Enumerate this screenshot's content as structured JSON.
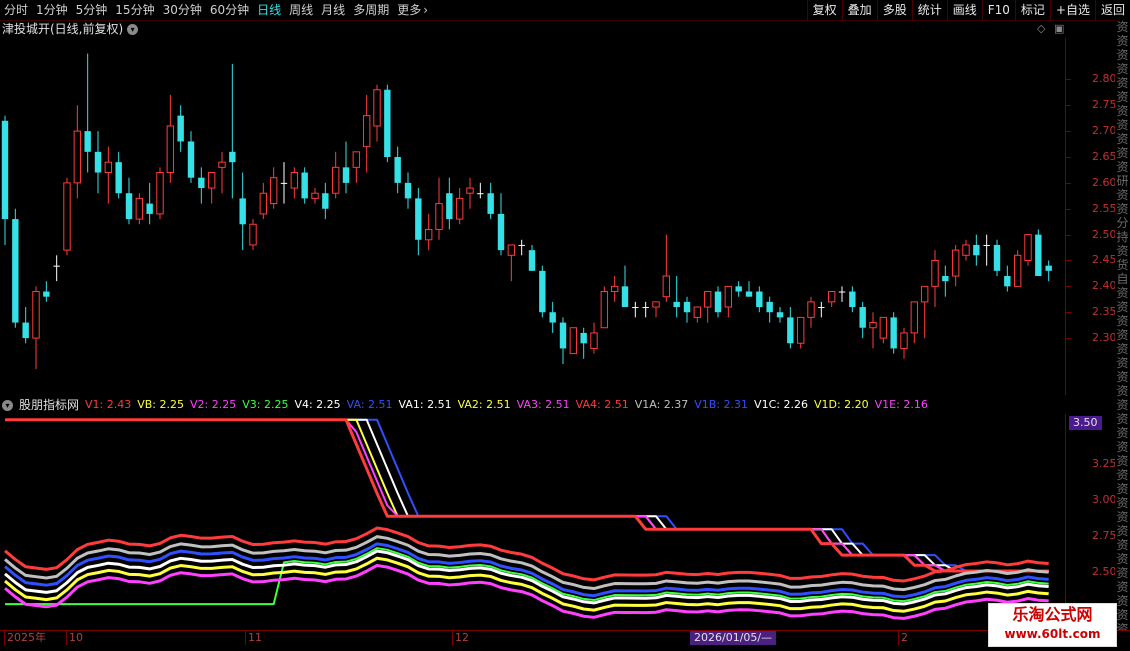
{
  "toolbar": {
    "periods": [
      "分时",
      "1分钟",
      "5分钟",
      "15分钟",
      "30分钟",
      "60分钟",
      "日线",
      "周线",
      "月线",
      "多周期",
      "更多"
    ],
    "active_period": "日线",
    "more_arrow": "›",
    "right_buttons": [
      "复权",
      "叠加",
      "多股",
      "统计",
      "画线",
      "F10",
      "标记",
      "+自选",
      "返回"
    ]
  },
  "main": {
    "title": "津投城开(日线,前复权)",
    "icon_names": [
      "chevron-down-icon",
      "diamond-icon",
      "window-icon"
    ],
    "up_color": "#ff3b3b",
    "down_color": "#35e0e6",
    "flat_color": "#ffffff",
    "y_range": [
      2.19,
      2.88
    ],
    "y_ticks": [
      "2.80",
      "2.75",
      "2.70",
      "2.65",
      "2.60",
      "2.55",
      "2.50",
      "2.45",
      "2.40",
      "2.35",
      "2.30"
    ],
    "candles": [
      [
        2.72,
        2.73,
        2.48,
        2.53
      ],
      [
        2.53,
        2.55,
        2.32,
        2.33
      ],
      [
        2.33,
        2.36,
        2.29,
        2.3
      ],
      [
        2.3,
        2.4,
        2.24,
        2.39
      ],
      [
        2.39,
        2.41,
        2.37,
        2.38
      ],
      [
        2.44,
        2.46,
        2.41,
        2.44
      ],
      [
        2.47,
        2.61,
        2.46,
        2.6
      ],
      [
        2.6,
        2.75,
        2.57,
        2.7
      ],
      [
        2.7,
        2.85,
        2.62,
        2.66
      ],
      [
        2.66,
        2.7,
        2.58,
        2.62
      ],
      [
        2.62,
        2.67,
        2.56,
        2.64
      ],
      [
        2.64,
        2.66,
        2.57,
        2.58
      ],
      [
        2.58,
        2.61,
        2.52,
        2.53
      ],
      [
        2.53,
        2.58,
        2.52,
        2.57
      ],
      [
        2.56,
        2.6,
        2.52,
        2.54
      ],
      [
        2.54,
        2.63,
        2.53,
        2.62
      ],
      [
        2.62,
        2.77,
        2.6,
        2.71
      ],
      [
        2.73,
        2.75,
        2.66,
        2.68
      ],
      [
        2.68,
        2.7,
        2.6,
        2.61
      ],
      [
        2.61,
        2.63,
        2.56,
        2.59
      ],
      [
        2.59,
        2.62,
        2.56,
        2.62
      ],
      [
        2.63,
        2.66,
        2.58,
        2.64
      ],
      [
        2.66,
        2.83,
        2.57,
        2.64
      ],
      [
        2.57,
        2.62,
        2.47,
        2.52
      ],
      [
        2.48,
        2.53,
        2.47,
        2.52
      ],
      [
        2.54,
        2.6,
        2.53,
        2.58
      ],
      [
        2.56,
        2.63,
        2.55,
        2.61
      ],
      [
        2.6,
        2.64,
        2.56,
        2.6
      ],
      [
        2.59,
        2.63,
        2.57,
        2.62
      ],
      [
        2.62,
        2.63,
        2.56,
        2.57
      ],
      [
        2.57,
        2.59,
        2.56,
        2.58
      ],
      [
        2.58,
        2.6,
        2.53,
        2.55
      ],
      [
        2.58,
        2.66,
        2.57,
        2.63
      ],
      [
        2.63,
        2.68,
        2.58,
        2.6
      ],
      [
        2.63,
        2.66,
        2.6,
        2.66
      ],
      [
        2.67,
        2.77,
        2.62,
        2.73
      ],
      [
        2.71,
        2.79,
        2.68,
        2.78
      ],
      [
        2.78,
        2.79,
        2.64,
        2.65
      ],
      [
        2.65,
        2.67,
        2.58,
        2.6
      ],
      [
        2.6,
        2.62,
        2.55,
        2.57
      ],
      [
        2.57,
        2.59,
        2.46,
        2.49
      ],
      [
        2.49,
        2.54,
        2.47,
        2.51
      ],
      [
        2.51,
        2.61,
        2.49,
        2.56
      ],
      [
        2.58,
        2.61,
        2.51,
        2.53
      ],
      [
        2.53,
        2.59,
        2.52,
        2.57
      ],
      [
        2.58,
        2.61,
        2.55,
        2.59
      ],
      [
        2.58,
        2.6,
        2.57,
        2.58
      ],
      [
        2.58,
        2.6,
        2.53,
        2.54
      ],
      [
        2.54,
        2.58,
        2.46,
        2.47
      ],
      [
        2.46,
        2.48,
        2.41,
        2.48
      ],
      [
        2.48,
        2.49,
        2.46,
        2.48
      ],
      [
        2.47,
        2.48,
        2.43,
        2.43
      ],
      [
        2.43,
        2.44,
        2.34,
        2.35
      ],
      [
        2.35,
        2.37,
        2.31,
        2.33
      ],
      [
        2.33,
        2.34,
        2.25,
        2.28
      ],
      [
        2.27,
        2.32,
        2.27,
        2.32
      ],
      [
        2.31,
        2.32,
        2.26,
        2.29
      ],
      [
        2.28,
        2.33,
        2.27,
        2.31
      ],
      [
        2.32,
        2.4,
        2.32,
        2.39
      ],
      [
        2.39,
        2.42,
        2.37,
        2.4
      ],
      [
        2.4,
        2.44,
        2.36,
        2.36
      ],
      [
        2.36,
        2.37,
        2.34,
        2.36
      ],
      [
        2.36,
        2.37,
        2.34,
        2.36
      ],
      [
        2.36,
        2.37,
        2.34,
        2.37
      ],
      [
        2.38,
        2.5,
        2.37,
        2.42
      ],
      [
        2.37,
        2.42,
        2.34,
        2.36
      ],
      [
        2.37,
        2.38,
        2.33,
        2.35
      ],
      [
        2.34,
        2.36,
        2.33,
        2.36
      ],
      [
        2.36,
        2.39,
        2.33,
        2.39
      ],
      [
        2.39,
        2.4,
        2.34,
        2.35
      ],
      [
        2.36,
        2.4,
        2.34,
        2.4
      ],
      [
        2.4,
        2.41,
        2.38,
        2.39
      ],
      [
        2.39,
        2.41,
        2.38,
        2.38
      ],
      [
        2.39,
        2.4,
        2.35,
        2.36
      ],
      [
        2.37,
        2.38,
        2.33,
        2.35
      ],
      [
        2.35,
        2.36,
        2.33,
        2.34
      ],
      [
        2.34,
        2.36,
        2.28,
        2.29
      ],
      [
        2.29,
        2.34,
        2.28,
        2.34
      ],
      [
        2.34,
        2.38,
        2.32,
        2.37
      ],
      [
        2.36,
        2.37,
        2.34,
        2.36
      ],
      [
        2.37,
        2.39,
        2.36,
        2.39
      ],
      [
        2.39,
        2.4,
        2.37,
        2.39
      ],
      [
        2.39,
        2.4,
        2.35,
        2.36
      ],
      [
        2.36,
        2.37,
        2.3,
        2.32
      ],
      [
        2.32,
        2.35,
        2.28,
        2.33
      ],
      [
        2.3,
        2.34,
        2.29,
        2.34
      ],
      [
        2.34,
        2.35,
        2.27,
        2.28
      ],
      [
        2.28,
        2.32,
        2.26,
        2.31
      ],
      [
        2.31,
        2.37,
        2.29,
        2.37
      ],
      [
        2.37,
        2.4,
        2.3,
        2.4
      ],
      [
        2.4,
        2.47,
        2.36,
        2.45
      ],
      [
        2.42,
        2.44,
        2.38,
        2.41
      ],
      [
        2.42,
        2.48,
        2.4,
        2.47
      ],
      [
        2.46,
        2.49,
        2.45,
        2.48
      ],
      [
        2.48,
        2.5,
        2.44,
        2.46
      ],
      [
        2.48,
        2.5,
        2.44,
        2.48
      ],
      [
        2.48,
        2.49,
        2.42,
        2.43
      ],
      [
        2.42,
        2.44,
        2.39,
        2.4
      ],
      [
        2.4,
        2.47,
        2.4,
        2.46
      ],
      [
        2.45,
        2.5,
        2.44,
        2.5
      ],
      [
        2.5,
        2.51,
        2.42,
        2.42
      ],
      [
        2.44,
        2.45,
        2.41,
        2.43
      ]
    ]
  },
  "sub": {
    "title": "股朋指标网",
    "y_range": [
      2.1,
      3.6
    ],
    "y_ticks": [
      "3.25",
      "3.00",
      "2.75",
      "2.50",
      "2.25"
    ],
    "badge_value": "3.50",
    "legend": [
      {
        "label": "V1: 2.43",
        "color": "#ff3b3b"
      },
      {
        "label": "VB: 2.25",
        "color": "#ffff40"
      },
      {
        "label": "V2: 2.25",
        "color": "#ff40ff"
      },
      {
        "label": "V3: 2.25",
        "color": "#40ff40"
      },
      {
        "label": "V4: 2.25",
        "color": "#ffffff"
      },
      {
        "label": "VA: 2.51",
        "color": "#3050ff"
      },
      {
        "label": "VA1: 2.51",
        "color": "#ffffff"
      },
      {
        "label": "VA2: 2.51",
        "color": "#ffff40"
      },
      {
        "label": "VA3: 2.51",
        "color": "#ff40ff"
      },
      {
        "label": "VA4: 2.51",
        "color": "#ff3b3b"
      },
      {
        "label": "V1A: 2.37",
        "color": "#c0c0c0"
      },
      {
        "label": "V1B: 2.31",
        "color": "#3050ff"
      },
      {
        "label": "V1C: 2.26",
        "color": "#ffffff"
      },
      {
        "label": "V1D: 2.20",
        "color": "#ffff40"
      },
      {
        "label": "V1E: 2.16",
        "color": "#ff40ff"
      }
    ]
  },
  "chart_data": [
    {
      "type": "candlestick",
      "title": "津投城开(日线,前复权)",
      "ylim": [
        2.19,
        2.88
      ]
    },
    {
      "type": "line",
      "title": "股朋指标网",
      "ylim": [
        2.1,
        3.6
      ]
    }
  ],
  "date_axis": {
    "labels": [
      "2025年",
      "10",
      "11",
      "12",
      "2"
    ],
    "cursor": "2026/01/05/—"
  },
  "right_strip": [
    "资",
    "资",
    "资",
    "资",
    "资",
    "资",
    "资",
    "资",
    "资",
    "资",
    "资",
    "研",
    "资",
    "资",
    "分",
    "持",
    "资",
    "货",
    "自",
    "资",
    "资",
    "资",
    "资",
    "资",
    "资",
    "资",
    "资",
    "资",
    "资",
    "资",
    "资",
    "资",
    "资",
    "资",
    "资",
    "资",
    "资",
    "资",
    "资",
    "资",
    "资",
    "资",
    "资",
    "资"
  ],
  "watermark": {
    "line1": "乐淘公式网",
    "line2": "www.60lt.com"
  }
}
